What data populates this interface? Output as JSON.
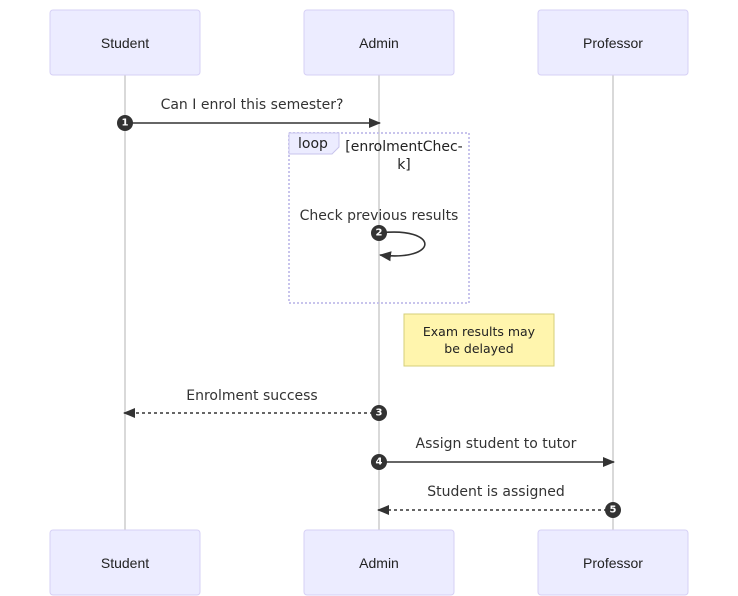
{
  "diagram": {
    "type": "sequence",
    "actors": [
      {
        "id": "student",
        "label": "Student"
      },
      {
        "id": "admin",
        "label": "Admin"
      },
      {
        "id": "professor",
        "label": "Professor"
      }
    ],
    "messages": [
      {
        "seq": "1",
        "from": "student",
        "to": "admin",
        "text": "Can I enrol this semester?",
        "style": "solid"
      },
      {
        "seq": "2",
        "from": "admin",
        "to": "admin",
        "text": "Check previous results",
        "style": "solid"
      },
      {
        "seq": "3",
        "from": "admin",
        "to": "student",
        "text": "Enrolment success",
        "style": "dotted"
      },
      {
        "seq": "4",
        "from": "admin",
        "to": "professor",
        "text": "Assign student to tutor",
        "style": "solid"
      },
      {
        "seq": "5",
        "from": "professor",
        "to": "admin",
        "text": "Student is assigned",
        "style": "dotted"
      }
    ],
    "loop": {
      "label": "loop",
      "condition_line1": "[enrolmentChec-",
      "condition_line2": "k]"
    },
    "note": {
      "line1": "Exam results may",
      "line2": "be delayed",
      "position": "right of Admin"
    },
    "colors": {
      "actor_fill": "#ececff",
      "actor_border": "#d6d0f5",
      "lifeline": "#d9d9d9",
      "message": "#333333",
      "note_fill": "#fff5ad",
      "note_border": "#d5cf7a"
    }
  }
}
